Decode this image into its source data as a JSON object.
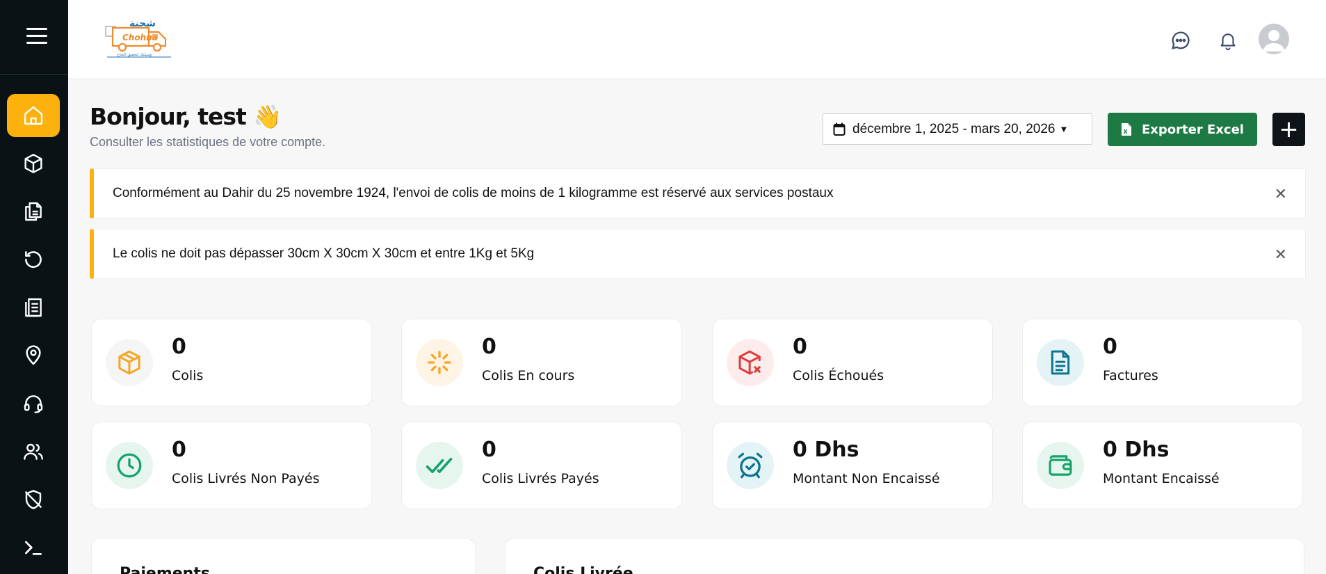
{
  "sidebar": {
    "items": [
      {
        "icon": "home-icon",
        "active": true
      },
      {
        "icon": "package-icon"
      },
      {
        "icon": "documents-icon"
      },
      {
        "icon": "returns-icon"
      },
      {
        "icon": "invoice-icon"
      },
      {
        "icon": "location-icon"
      },
      {
        "icon": "support-headset-icon"
      },
      {
        "icon": "users-icon"
      },
      {
        "icon": "shield-off-icon"
      },
      {
        "icon": "terminal-icon"
      }
    ]
  },
  "header": {
    "logo_text": "Chohna",
    "logo_tagline": "وسيلتك لتحقيق النجاح"
  },
  "main": {
    "greeting": "Bonjour, test 👋",
    "subtitle": "Consulter les statistiques de votre compte.",
    "date_range": "décembre 1, 2025 - mars 20, 2026",
    "export_label": "Exporter Excel",
    "add_label": "+"
  },
  "alerts": [
    {
      "text": "Conformément au Dahir du 25 novembre 1924, l'envoi de colis de moins de 1 kilogramme est réservé aux services postaux"
    },
    {
      "text": "Le colis ne doit pas dépasser 30cm X 30cm X 30cm et entre 1Kg et 5Kg"
    }
  ],
  "stats": [
    {
      "value": "0",
      "label": "Colis",
      "icon": "box-icon",
      "color": "#f5a623"
    },
    {
      "value": "0",
      "label": "Colis En cours",
      "icon": "loader-icon",
      "color": "#f5a623"
    },
    {
      "value": "0",
      "label": "Colis Échoués",
      "icon": "box-x-icon",
      "color": "#e03b3b"
    },
    {
      "value": "0",
      "label": "Factures",
      "icon": "file-text-icon",
      "color": "#0e7490"
    },
    {
      "value": "0",
      "label": "Colis Livrés Non Payés",
      "icon": "clock-icon",
      "color": "#16a36a"
    },
    {
      "value": "0",
      "label": "Colis Livrés Payés",
      "icon": "check-double-icon",
      "color": "#16a36a"
    },
    {
      "value": "0 Dhs",
      "label": "Montant Non Encaissé",
      "icon": "alarm-check-icon",
      "color": "#0e7490"
    },
    {
      "value": "0 Dhs",
      "label": "Montant Encaissé",
      "icon": "wallet-icon",
      "color": "#16a36a"
    }
  ],
  "panels": [
    {
      "title": "Paiements"
    },
    {
      "title": "Colis Livrée"
    }
  ],
  "colors": {
    "accent": "#fdb10d",
    "sidebar_bg": "#0a1216",
    "export_green": "#1e7a45"
  }
}
